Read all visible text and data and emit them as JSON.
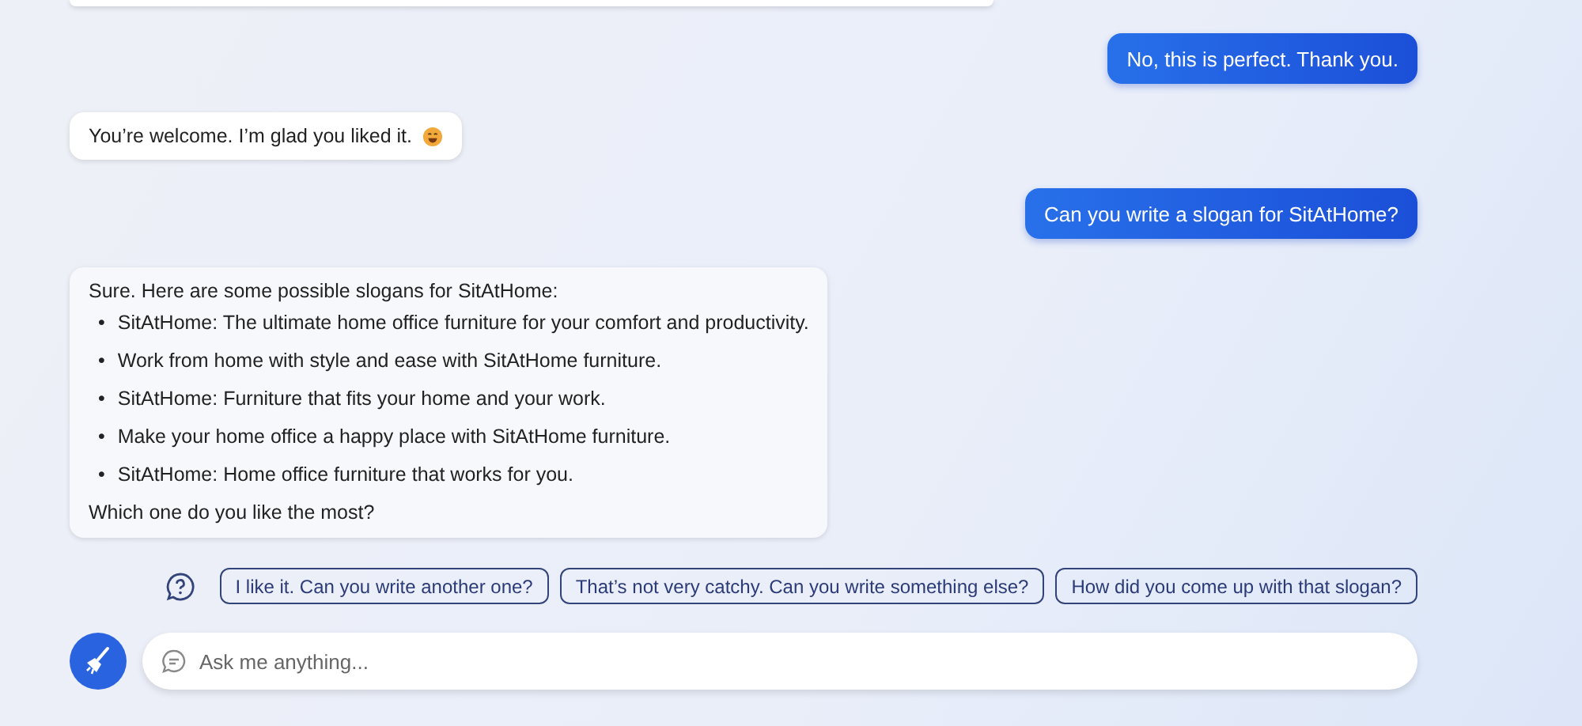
{
  "conversation": [
    {
      "kind": "partial"
    },
    {
      "kind": "user",
      "text": "No, this is perfect. Thank you."
    },
    {
      "kind": "bot",
      "text": "You’re welcome. I’m glad you liked it.",
      "emoji": true
    },
    {
      "kind": "user",
      "text": "Can you write a slogan for SitAtHome?"
    },
    {
      "kind": "bot",
      "text": "Sure. Here are some possible slogans for SitAtHome:",
      "bullet": "•",
      "items": [
        "SitAtHome: The ultimate home office furniture for your comfort and productivity.",
        "Work from home with style and ease with SitAtHome furniture.",
        "SitAtHome: Furniture that fits your home and your work.",
        "Make your home office a happy place with SitAtHome furniture.",
        "SitAtHome: Home office furniture that works for you."
      ],
      "outro": "Which one do you like the most?"
    }
  ],
  "suggestions": [
    "I like it. Can you write another one?",
    "That’s not very catchy. Can you write something else?",
    "How did you come up with that slogan?"
  ],
  "input": {
    "placeholder": "Ask me anything..."
  }
}
